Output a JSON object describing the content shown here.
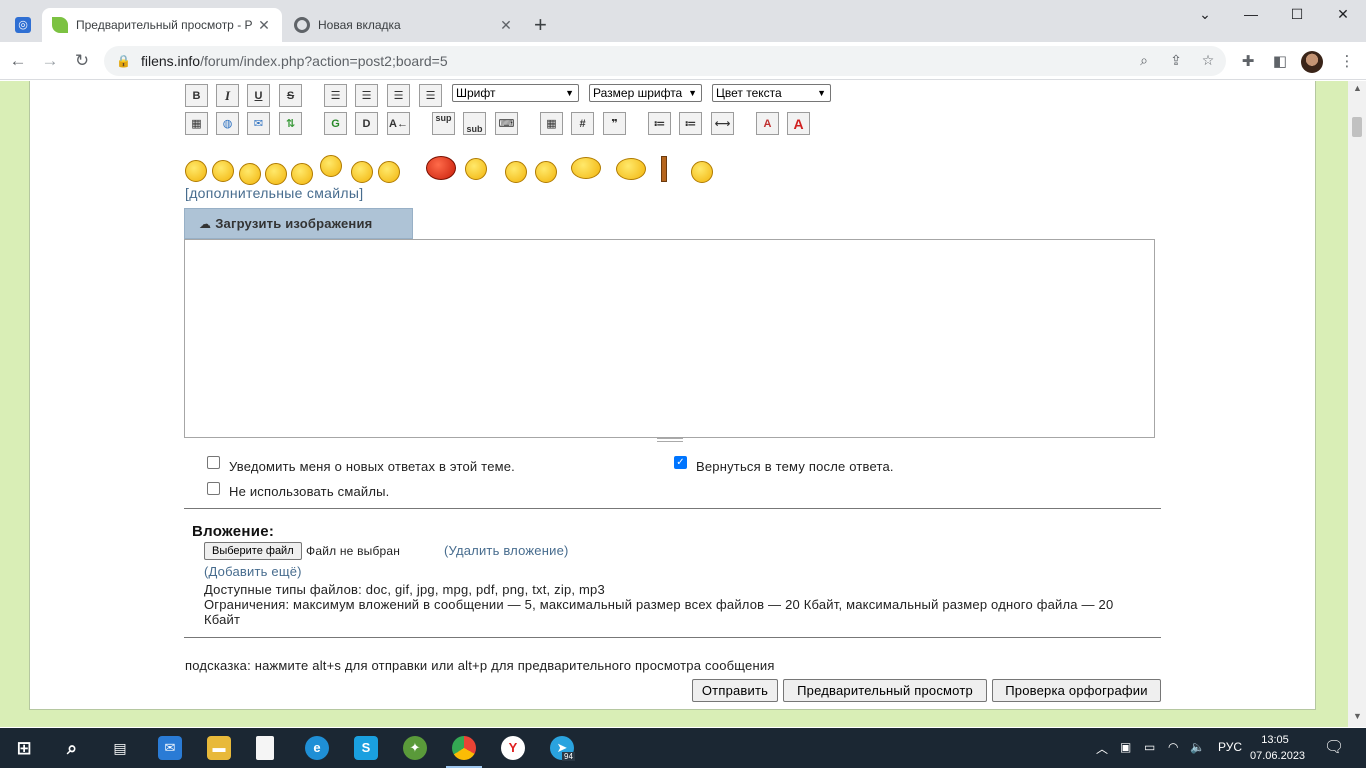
{
  "browser": {
    "tabs": [
      {
        "title": "Предварительный просмотр - Р",
        "active": true
      },
      {
        "title": "Новая вкладка",
        "active": false
      }
    ],
    "url_host": "filens.info",
    "url_path": "/forum/index.php?action=post2;board=5"
  },
  "editor": {
    "font_select": "Шрифт",
    "size_select": "Размер шрифта",
    "color_select": "Цвет текста",
    "format_buttons": [
      "B",
      "I",
      "U",
      "S"
    ],
    "more_smileys": "[дополнительные смайлы]",
    "upload_label": "Загрузить изображения"
  },
  "options": {
    "notify_label": "Уведомить меня о новых ответах в этой теме.",
    "notify_checked": false,
    "return_label": "Вернуться в тему после ответа.",
    "return_checked": true,
    "no_smileys_label": "Не использовать смайлы.",
    "no_smileys_checked": false
  },
  "attachment": {
    "title": "Вложение:",
    "choose_file": "Выберите файл",
    "no_file": "Файл не выбран",
    "remove": "(Удалить вложение)",
    "add_more": "(Добавить ещё)",
    "allowed_types": "Доступные типы файлов: doc, gif, jpg, mpg, pdf, png, txt, zip, mp3",
    "limits": "Ограничения: максимум вложений в сообщении — 5, максимальный размер всех файлов — 20 Кбайт, максимальный размер одного файла — 20 Кбайт"
  },
  "hint": "подсказка: нажмите alt+s для отправки или alt+p для предварительного просмотра сообщения",
  "buttons": {
    "send": "Отправить",
    "preview": "Предварительный просмотр",
    "spellcheck": "Проверка орфографии"
  },
  "taskbar": {
    "lang": "РУС",
    "time": "13:05",
    "date": "07.06.2023",
    "telegram_badge": "94"
  }
}
